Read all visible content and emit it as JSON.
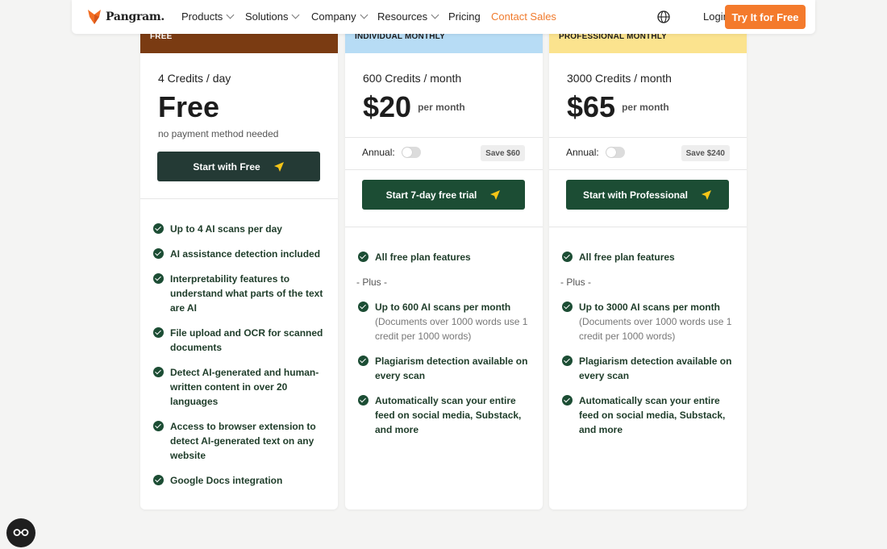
{
  "nav": {
    "brand": "Pangram.",
    "items": [
      {
        "label": "Products",
        "dropdown": true
      },
      {
        "label": "Solutions",
        "dropdown": true
      },
      {
        "label": "Company",
        "dropdown": true
      },
      {
        "label": "Resources",
        "dropdown": true
      },
      {
        "label": "Pricing",
        "dropdown": false
      },
      {
        "label": "Contact Sales",
        "dropdown": false
      }
    ],
    "login": "Login",
    "cta": "Try It for Free"
  },
  "colors": {
    "accent": "#f47a2c",
    "dark_green": "#1c4d34",
    "free_header": "#7a3b12",
    "individual_header": "#b7dcf5",
    "professional_header": "#fbe38e"
  },
  "plans": {
    "free": {
      "header": "FREE",
      "credits": "4 Credits / day",
      "price": "Free",
      "note": "no payment method needed",
      "cta": "Start with Free",
      "features": [
        "Up to 4 AI scans per day",
        "AI assistance detection included",
        "Interpretability features to understand what parts of the text are AI",
        "File upload and OCR for scanned documents",
        "Detect AI-generated and human-written content in over 20 languages",
        "Access to browser extension to detect AI-generated text on any website",
        "Google Docs integration"
      ]
    },
    "individual": {
      "header": "INDIVIDUAL MONTHLY",
      "credits": "600 Credits / month",
      "price": "$20",
      "price_unit": "per month",
      "annual_label": "Annual:",
      "save": "Save $60",
      "cta": "Start 7-day free trial",
      "feature_first": "All free plan features",
      "plus": "- Plus -",
      "scans_title": "Up to 600 AI scans per month",
      "scans_note": "(Documents over 1000 words use 1 credit per 1000 words)",
      "plagiarism": "Plagiarism detection available on every scan",
      "autoscan": "Automatically scan your entire feed on social media, Substack, and more"
    },
    "professional": {
      "header": "PROFESSIONAL MONTHLY",
      "credits": "3000 Credits / month",
      "price": "$65",
      "price_unit": "per month",
      "annual_label": "Annual:",
      "save": "Save $240",
      "cta": "Start with Professional",
      "feature_first": "All free plan features",
      "plus": "- Plus -",
      "scans_title": "Up to 3000 AI scans per month",
      "scans_note": "(Documents over 1000 words use 1 credit per 1000 words)",
      "plagiarism": "Plagiarism detection available on every scan",
      "autoscan": "Automatically scan your entire feed on social media, Substack, and more"
    }
  },
  "icons": {
    "logo": "fox-logo-icon",
    "globe": "globe-icon",
    "check": "check-circle-icon",
    "arrow": "paper-plane-arrow-icon",
    "fab": "glasses-icon"
  }
}
